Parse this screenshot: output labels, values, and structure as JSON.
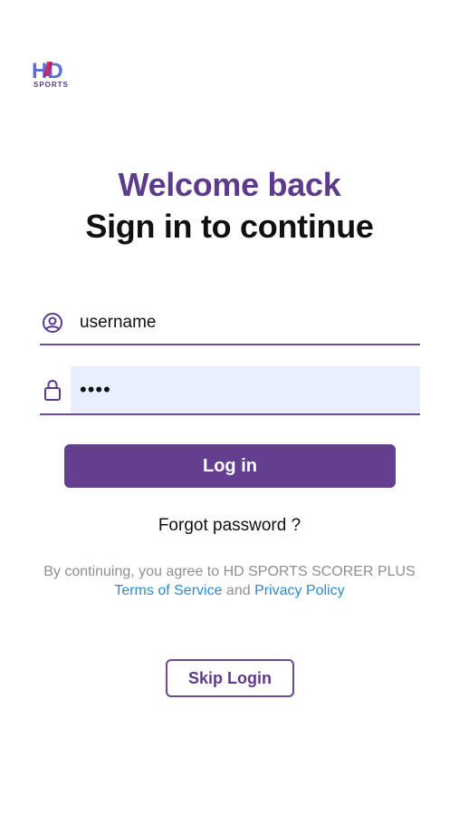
{
  "logo": {
    "text": "HD",
    "subtext": "SPORTS"
  },
  "header": {
    "welcome": "Welcome back",
    "subtitle": "Sign in to continue"
  },
  "form": {
    "username_value": "username",
    "password_value": "••••",
    "login_label": "Log in"
  },
  "links": {
    "forgot": "Forgot password ?",
    "terms_prefix": "By continuing, you agree to HD SPORTS SCORER PLUS",
    "terms_of_service": "Terms of Service",
    "and": "and",
    "privacy_policy": "Privacy Policy"
  },
  "skip_label": "Skip Login",
  "colors": {
    "brand": "#5e3a8c",
    "button": "#643f8f",
    "link": "#2a8ad4",
    "field_fill": "#e8f0fe"
  },
  "icons": {
    "user": "account-circle-icon",
    "lock": "lock-icon"
  }
}
